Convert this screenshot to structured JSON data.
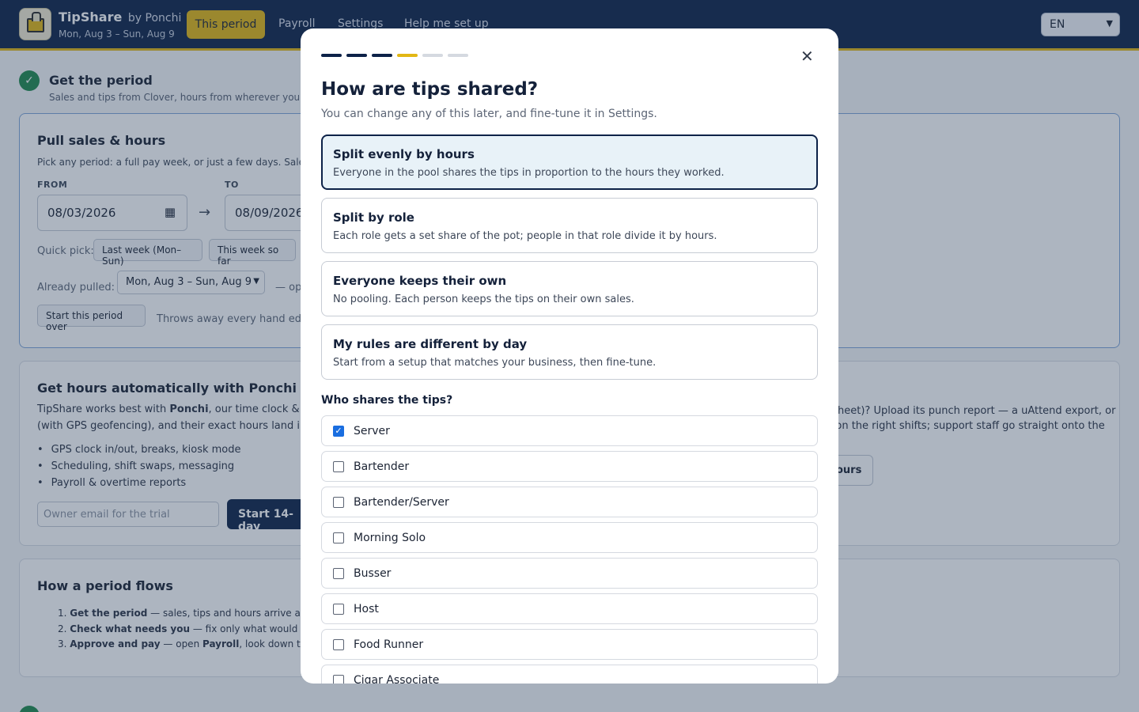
{
  "header": {
    "brand": "TipShare",
    "brand_by": "by Ponchi",
    "period": "Mon, Aug 3 – Sun, Aug 9",
    "nav": [
      "This period",
      "Payroll",
      "Settings",
      "Help me set up"
    ],
    "language": "EN"
  },
  "page": {
    "step_title": "Get the period",
    "step_sub": "Sales and tips from Clover, hours from wherever you ke",
    "pull": {
      "title": "Pull sales & hours",
      "desc": "Pick any period: a full pay week, or just a few days. Sales, c",
      "from_label": "FROM",
      "to_label": "TO",
      "from_value": "08/03/2026",
      "to_value": "08/09/2026",
      "quick_pick_label": "Quick pick:",
      "quick_pick": [
        "Last week (Mon–Sun)",
        "This week so far"
      ],
      "already_pulled_label": "Already pulled:",
      "already_pulled_value": "Mon, Aug 3 – Sun, Aug 9",
      "already_pulled_note": "— op",
      "start_over": "Start this period over",
      "start_over_note": "Throws away every hand edit —"
    },
    "ponchi": {
      "title": "Get hours automatically with Ponchi",
      "desc_1": "TipShare works best with ",
      "desc_bold": "Ponchi",
      "desc_2": ", our time clock & sch",
      "desc_line2": "(with GPS geofencing), and their exact hours land in ev",
      "bullets": [
        "GPS clock in/out, breaks, kiosk mode",
        "Scheduling, shift swaps, messaging",
        "Payroll & overtime reports"
      ],
      "email_placeholder": "Owner email for the trial",
      "trial_button": "Start 14-day",
      "right_line1": "dsheet)? Upload its punch report — a uAttend export, or",
      "right_line2": "d on the right shifts; support staff go straight onto the",
      "hours_button": "ours"
    },
    "flow": {
      "title": "How a period flows",
      "items": [
        {
          "bold": "Get the period",
          "rest": " — sales, tips and hours arrive attrib"
        },
        {
          "bold": "Check what needs you",
          "rest": " — fix only what would pay"
        },
        {
          "bold": "Approve and pay",
          "rest": " — open ",
          "bold2": "Payroll",
          "rest2": ", look down the"
        }
      ]
    }
  },
  "modal": {
    "progress_steps": 6,
    "progress_current": 4,
    "colors": {
      "done": "#0d2248",
      "current": "#e2b714",
      "todo": "#d5d9e0"
    },
    "title": "How are tips shared?",
    "subtitle": "You can change any of this later, and fine-tune it in Settings.",
    "options": [
      {
        "title": "Split evenly by hours",
        "desc": "Everyone in the pool shares the tips in proportion to the hours they worked.",
        "selected": true
      },
      {
        "title": "Split by role",
        "desc": "Each role gets a set share of the pot; people in that role divide it by hours.",
        "selected": false
      },
      {
        "title": "Everyone keeps their own",
        "desc": "No pooling. Each person keeps the tips on their own sales.",
        "selected": false
      },
      {
        "title": "My rules are different by day",
        "desc": "Start from a setup that matches your business, then fine-tune.",
        "selected": false
      }
    ],
    "who_label": "Who shares the tips?",
    "roles": [
      {
        "name": "Server",
        "checked": true
      },
      {
        "name": "Bartender",
        "checked": false
      },
      {
        "name": "Bartender/Server",
        "checked": false
      },
      {
        "name": "Morning Solo",
        "checked": false
      },
      {
        "name": "Busser",
        "checked": false
      },
      {
        "name": "Host",
        "checked": false
      },
      {
        "name": "Food Runner",
        "checked": false
      },
      {
        "name": "Cigar Associate",
        "checked": false
      }
    ]
  }
}
